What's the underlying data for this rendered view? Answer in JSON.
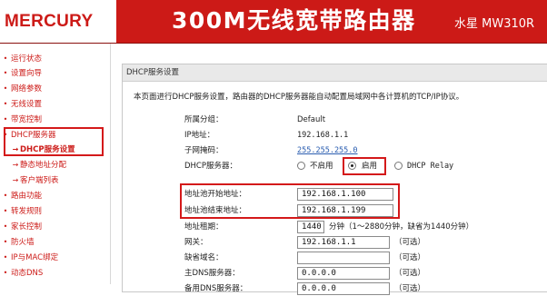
{
  "header": {
    "logo": "MERCURY",
    "product_title": "300M无线宽带路由器",
    "model": "水星 MW310R"
  },
  "nav": {
    "items": [
      {
        "label": "运行状态",
        "level": 1
      },
      {
        "label": "设置向导",
        "level": 1
      },
      {
        "label": "网络参数",
        "level": 1
      },
      {
        "label": "无线设置",
        "level": 1
      },
      {
        "label": "带宽控制",
        "level": 1
      },
      {
        "label": "DHCP服务器",
        "level": 1,
        "expanded": true
      },
      {
        "label": "DHCP服务设置",
        "level": 2,
        "active": true
      },
      {
        "label": "静态地址分配",
        "level": 2
      },
      {
        "label": "客户端列表",
        "level": 2
      },
      {
        "label": "路由功能",
        "level": 1
      },
      {
        "label": "转发规则",
        "level": 1
      },
      {
        "label": "家长控制",
        "level": 1
      },
      {
        "label": "防火墙",
        "level": 1
      },
      {
        "label": "IP与MAC绑定",
        "level": 1
      },
      {
        "label": "动态DNS",
        "level": 1
      }
    ]
  },
  "main": {
    "panel_title": "DHCP服务设置",
    "description": "本页面进行DHCP服务设置，路由器的DHCP服务器能自动配置局域网中各计算机的TCP/IP协议。",
    "group_label": "所属分组：",
    "group_value": "Default",
    "ip_label": "IP地址：",
    "ip_value": "192.168.1.1",
    "mask_label": "子网掩码：",
    "mask_value": "255.255.255.0",
    "dhcp_label": "DHCP服务器：",
    "dhcp_options": [
      "不启用",
      "启用",
      "DHCP Relay"
    ],
    "dhcp_selected": "启用",
    "pool_start_label": "地址池开始地址：",
    "pool_start_value": "192.168.1.100",
    "pool_end_label": "地址池结束地址：",
    "pool_end_value": "192.168.1.199",
    "lease_label": "地址租期：",
    "lease_value": "1440",
    "lease_hint": "分钟（1～2880分钟，缺省为1440分钟）",
    "gateway_label": "网关：",
    "gateway_value": "192.168.1.1",
    "gateway_hint": "（可选）",
    "domain_label": "缺省域名：",
    "domain_value": "",
    "domain_hint": "（可选）",
    "dns1_label": "主DNS服务器：",
    "dns1_value": "0.0.0.0",
    "dns1_hint": "（可选）",
    "dns2_label": "备用DNS服务器：",
    "dns2_value": "0.0.0.0",
    "dns2_hint": "（可选）"
  },
  "colors": {
    "brand_red": "#cc1a17",
    "highlight_red": "#d4191a",
    "link_blue": "#2a5db0"
  }
}
